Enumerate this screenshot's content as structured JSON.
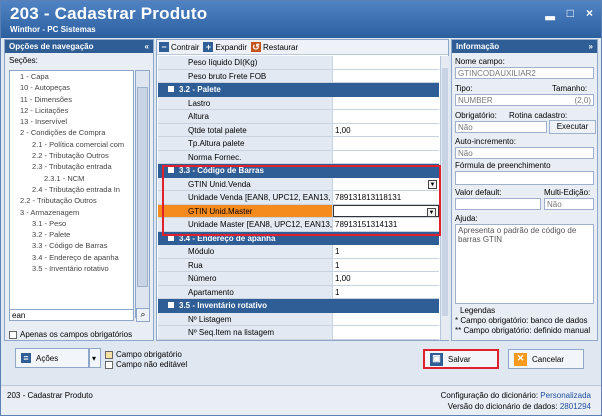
{
  "window": {
    "title": "203 - Cadastrar  Produto",
    "subtitle": "Winthor - PC Sistemas",
    "btn_min": "▂",
    "btn_max": "□",
    "btn_close": "×"
  },
  "left": {
    "header": "Opções de navegação",
    "collapse": "«",
    "sections_label": "Seções:",
    "tree": [
      "1 - Capa",
      "10 - Autopeças",
      "11 - Dimensões",
      "12 - Licitações",
      "13 - Inservível",
      "2 - Condições de Compra",
      "2.1 - Política comercial com",
      "2.2 - Tributação Outros",
      "2.3 - Tributação entrada",
      "2.3.1 - NCM",
      "2.4 - Tributação entrada In",
      "2.2 - Tributação Outros",
      "3 - Armazenagem",
      "3.1 - Peso",
      "3.2 - Palete",
      "3.3 - Código de Barras",
      "3.4 - Endereço de apanha",
      "3.5 - Inventário rotativo"
    ],
    "search_value": "ean",
    "required_only": "Apenas os campos obrigatórios"
  },
  "toolbar": {
    "collapse": "Contrair",
    "expand": "Expandir",
    "restore": "Restaurar"
  },
  "grid": {
    "top_rows": [
      {
        "label": "Peso líquido DI(Kg)",
        "value": ""
      },
      {
        "label": "Peso bruto Frete FOB",
        "value": ""
      }
    ],
    "cat_palete": "3.2 - Palete",
    "palete_rows": [
      {
        "label": "Lastro",
        "value": ""
      },
      {
        "label": "Altura",
        "value": ""
      },
      {
        "label": "Qtde total palete",
        "value": "1,00"
      },
      {
        "label": "Tp.Altura palete",
        "value": ""
      },
      {
        "label": "Norma Fornec.",
        "value": ""
      }
    ],
    "cat_barras": "3.3 - Código de Barras",
    "barras_rows": [
      {
        "label": "GTIN Unid.Venda",
        "value": ""
      },
      {
        "label": "Unidade Venda [EAN8, UPC12, EAN13, e",
        "value": "789131813118131"
      },
      {
        "label": "GTIN Unid.Master",
        "value": ""
      },
      {
        "label": "Unidade Master [EAN8, UPC12, EAN13, e",
        "value": "78913151314131"
      }
    ],
    "cat_apanha": "3.4 - Endereço de apanha",
    "apanha_rows": [
      {
        "label": "Módulo",
        "value": "1"
      },
      {
        "label": "Rua",
        "value": "1"
      },
      {
        "label": "Número",
        "value": "1,00"
      },
      {
        "label": "Apartamento",
        "value": "1"
      }
    ],
    "cat_inv": "3.5 - Inventário rotativo",
    "inv_rows": [
      {
        "label": "Nº Listagem",
        "value": ""
      },
      {
        "label": "Nº Seq.Item na listagem",
        "value": ""
      }
    ]
  },
  "info": {
    "header": "Informação",
    "collapse": "»",
    "field_name_label": "Nome campo:",
    "field_name": "GTINCODAUXILIAR2",
    "type_label": "Tipo:",
    "size_label": "Tamanho:",
    "type": "NUMBER",
    "size": "(2,0)",
    "required_label": "Obrigatório:",
    "routine_label": "Rotina cadastro:",
    "required": "Não",
    "execute": "Executar",
    "autoinc_label": "Auto-incremento:",
    "autoinc": "Não",
    "formula_label": "Fórmula de preenchimento",
    "default_label": "Valor default:",
    "multi_label": "Multi-Edição:",
    "multi": "Não",
    "help_label": "Ajuda:",
    "help": "Apresenta o padrão de código de barras GTIN",
    "legend_title": "Legendas",
    "legend1": "* Campo obrigatório: banco de dados",
    "legend2": "** Campo obrigatório: definido manual"
  },
  "bottom": {
    "actions": "Ações",
    "required_field": "Campo obrigatório",
    "non_editable": "Campo não editável",
    "save": "Salvar",
    "cancel": "Cancelar"
  },
  "status": {
    "left": "203 - Cadastrar  Produto",
    "dict_config_label": "Configuração do dicionário:",
    "dict_config": "Personalizada",
    "dict_version_label": "Versão do dicionário de dados:",
    "dict_version": "2801294"
  }
}
